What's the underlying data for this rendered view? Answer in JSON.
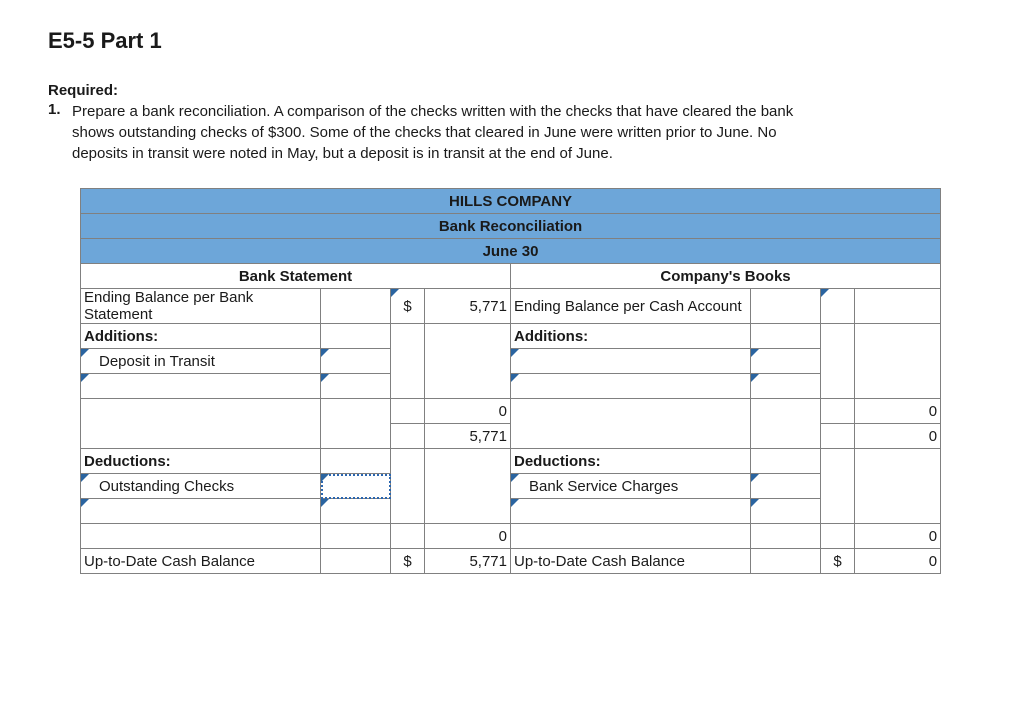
{
  "page": {
    "title": "E5-5 Part 1",
    "required_label": "Required:",
    "required_num": "1.",
    "required_text": "Prepare a bank reconciliation. A comparison of the checks written with the checks that have cleared the bank shows outstanding checks of $300. Some of the checks that cleared in June were written prior to June. No deposits in transit were noted in May, but a deposit is in transit at the end of June."
  },
  "header": {
    "company": "HILLS COMPANY",
    "title": "Bank Reconciliation",
    "date": "June 30"
  },
  "cols": {
    "left": "Bank Statement",
    "right": "Company's Books"
  },
  "left": {
    "ending_label": "Ending Balance per Bank Statement",
    "ending_cur": "$",
    "ending_val": "5,771",
    "additions_label": "Additions:",
    "add1": "Deposit in Transit",
    "subtotal_add": "0",
    "after_add": "5,771",
    "deductions_label": "Deductions:",
    "ded1": "Outstanding Checks",
    "subtotal_ded": "0",
    "uptodate_label": "Up-to-Date Cash Balance",
    "uptodate_cur": "$",
    "uptodate_val": "5,771"
  },
  "right": {
    "ending_label": "Ending Balance per Cash Account",
    "additions_label": "Additions:",
    "subtotal_add": "0",
    "after_add": "0",
    "deductions_label": "Deductions:",
    "ded1": "Bank Service Charges",
    "subtotal_ded": "0",
    "uptodate_label": "Up-to-Date Cash Balance",
    "uptodate_cur": "$",
    "uptodate_val": "0"
  }
}
